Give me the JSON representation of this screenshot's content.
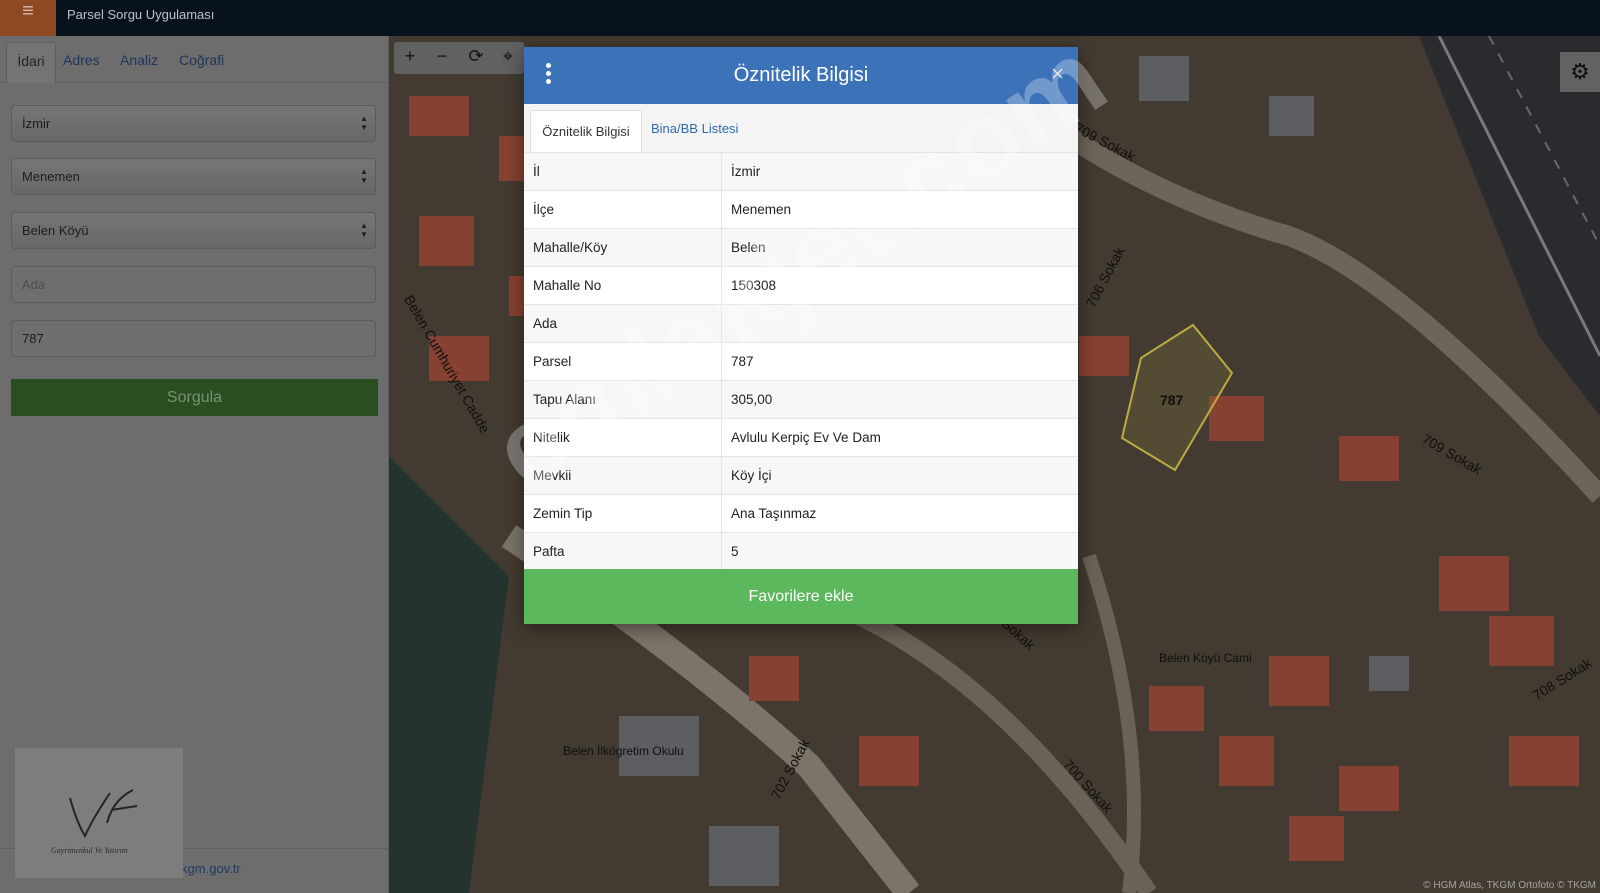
{
  "app": {
    "title": "Parsel Sorgu Uygulaması",
    "menu_icon": "hamburger-icon",
    "menu_glyph": "≡"
  },
  "sidebar": {
    "tabs": [
      {
        "label": "İdari"
      },
      {
        "label": "Adres"
      },
      {
        "label": "Analiz"
      },
      {
        "label": "Coğrafi"
      }
    ],
    "il": "İzmir",
    "ilce": "Menemen",
    "mahalle": "Belen Köyü",
    "ada_placeholder": "Ada",
    "parsel_value": "787",
    "submit_label": "Sorgula",
    "email": "cbs@tkgm.gov.tr",
    "logo": {
      "initials": "Vf",
      "caption": "Gayrimenkul Ve Yatırım"
    }
  },
  "map": {
    "toolbar": {
      "zoom_in": "+",
      "zoom_out": "−",
      "refresh": "⟳",
      "locate": "⌖"
    },
    "settings_glyph": "⚙",
    "attribution": "© HGM Atlas, TKGM Ortofoto © TKGM",
    "labels": {
      "street_709_top": "709 Sokak",
      "street_706": "706 Sokak",
      "street_709_right": "709 Sokak",
      "street_708": "708 Sokak",
      "street_700": "700 Sokak",
      "street_702": "702 Sokak",
      "street_sokak": "Sokak",
      "cadde": "Belen Cumhuriyet Cadde",
      "parcel": "787",
      "mosque": "Belen Köyü Cami",
      "school": "Belen İlkögretim Okulu"
    }
  },
  "modal": {
    "title": "Öznitelik Bilgisi",
    "close_glyph": "×",
    "tabs": [
      {
        "label": "Öznitelik Bilgisi"
      },
      {
        "label": "Bina/BB Listesi"
      }
    ],
    "rows": [
      {
        "key": "İl",
        "value": "İzmir"
      },
      {
        "key": "İlçe",
        "value": "Menemen"
      },
      {
        "key": "Mahalle/Köy",
        "value": "Belen"
      },
      {
        "key": "Mahalle No",
        "value": "150308"
      },
      {
        "key": "Ada",
        "value": ""
      },
      {
        "key": "Parsel",
        "value": "787"
      },
      {
        "key": "Tapu Alanı",
        "value": "305,00"
      },
      {
        "key": "Nitelik",
        "value": "Avlulu Kerpiç Ev Ve Dam"
      },
      {
        "key": "Mevkii",
        "value": "Köy İçi"
      },
      {
        "key": "Zemin Tip",
        "value": "Ana Taşınmaz"
      },
      {
        "key": "Pafta",
        "value": "5"
      }
    ],
    "favorite_label": "Favorilere ekle"
  },
  "watermark": "emlakjet.com",
  "colors": {
    "header": "#3b72b8",
    "favorite": "#5cb85c",
    "submit": "#2f5a26",
    "menu": "#a3532a"
  }
}
